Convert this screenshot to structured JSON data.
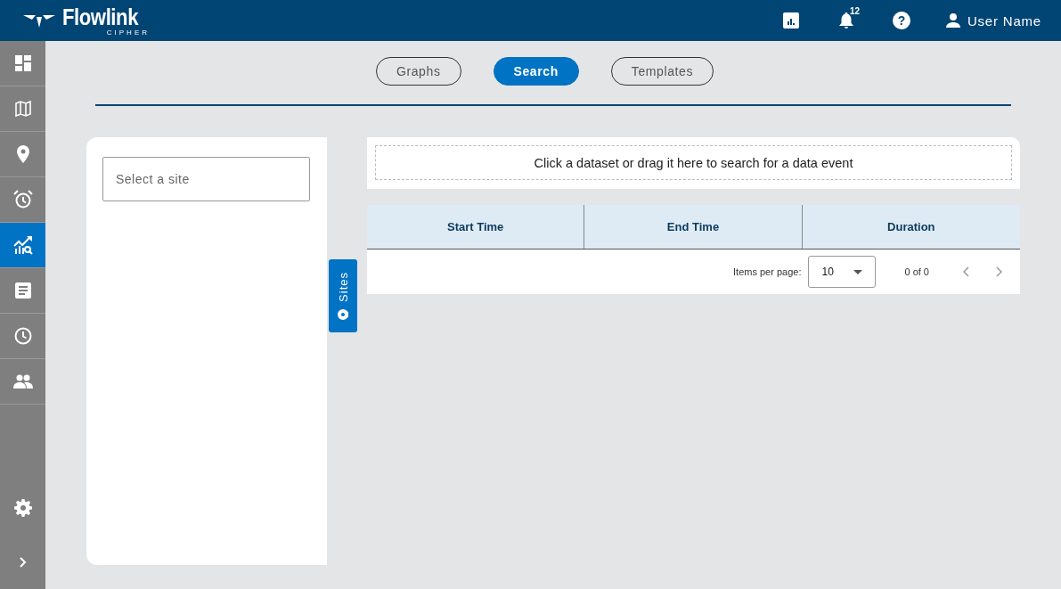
{
  "header": {
    "logo_text": "Flowlink",
    "logo_subtext": "CIPHER",
    "notification_count": "12",
    "help_glyph": "?",
    "user_name": "User Name"
  },
  "sidebar": {
    "items": [
      {
        "kind": "dashboard",
        "selected": false
      },
      {
        "kind": "map",
        "selected": false
      },
      {
        "kind": "pin",
        "selected": false
      },
      {
        "kind": "alarm",
        "selected": false
      },
      {
        "kind": "analysis",
        "selected": true
      },
      {
        "kind": "report",
        "selected": false
      },
      {
        "kind": "history",
        "selected": false
      },
      {
        "kind": "users",
        "selected": false
      }
    ]
  },
  "tabs": [
    {
      "label": "Graphs",
      "selected": false
    },
    {
      "label": "Search",
      "selected": true
    },
    {
      "label": "Templates",
      "selected": false
    }
  ],
  "site_select": {
    "placeholder": "Select a site"
  },
  "sites_toggle": {
    "label": "Sites"
  },
  "drop_zone": {
    "text": "Click a dataset or drag it here to search for a data event"
  },
  "table": {
    "columns": [
      "Start Time",
      "End Time",
      "Duration"
    ]
  },
  "paginator": {
    "label": "Items per page:",
    "page_size": "10",
    "range": "0 of 0"
  }
}
